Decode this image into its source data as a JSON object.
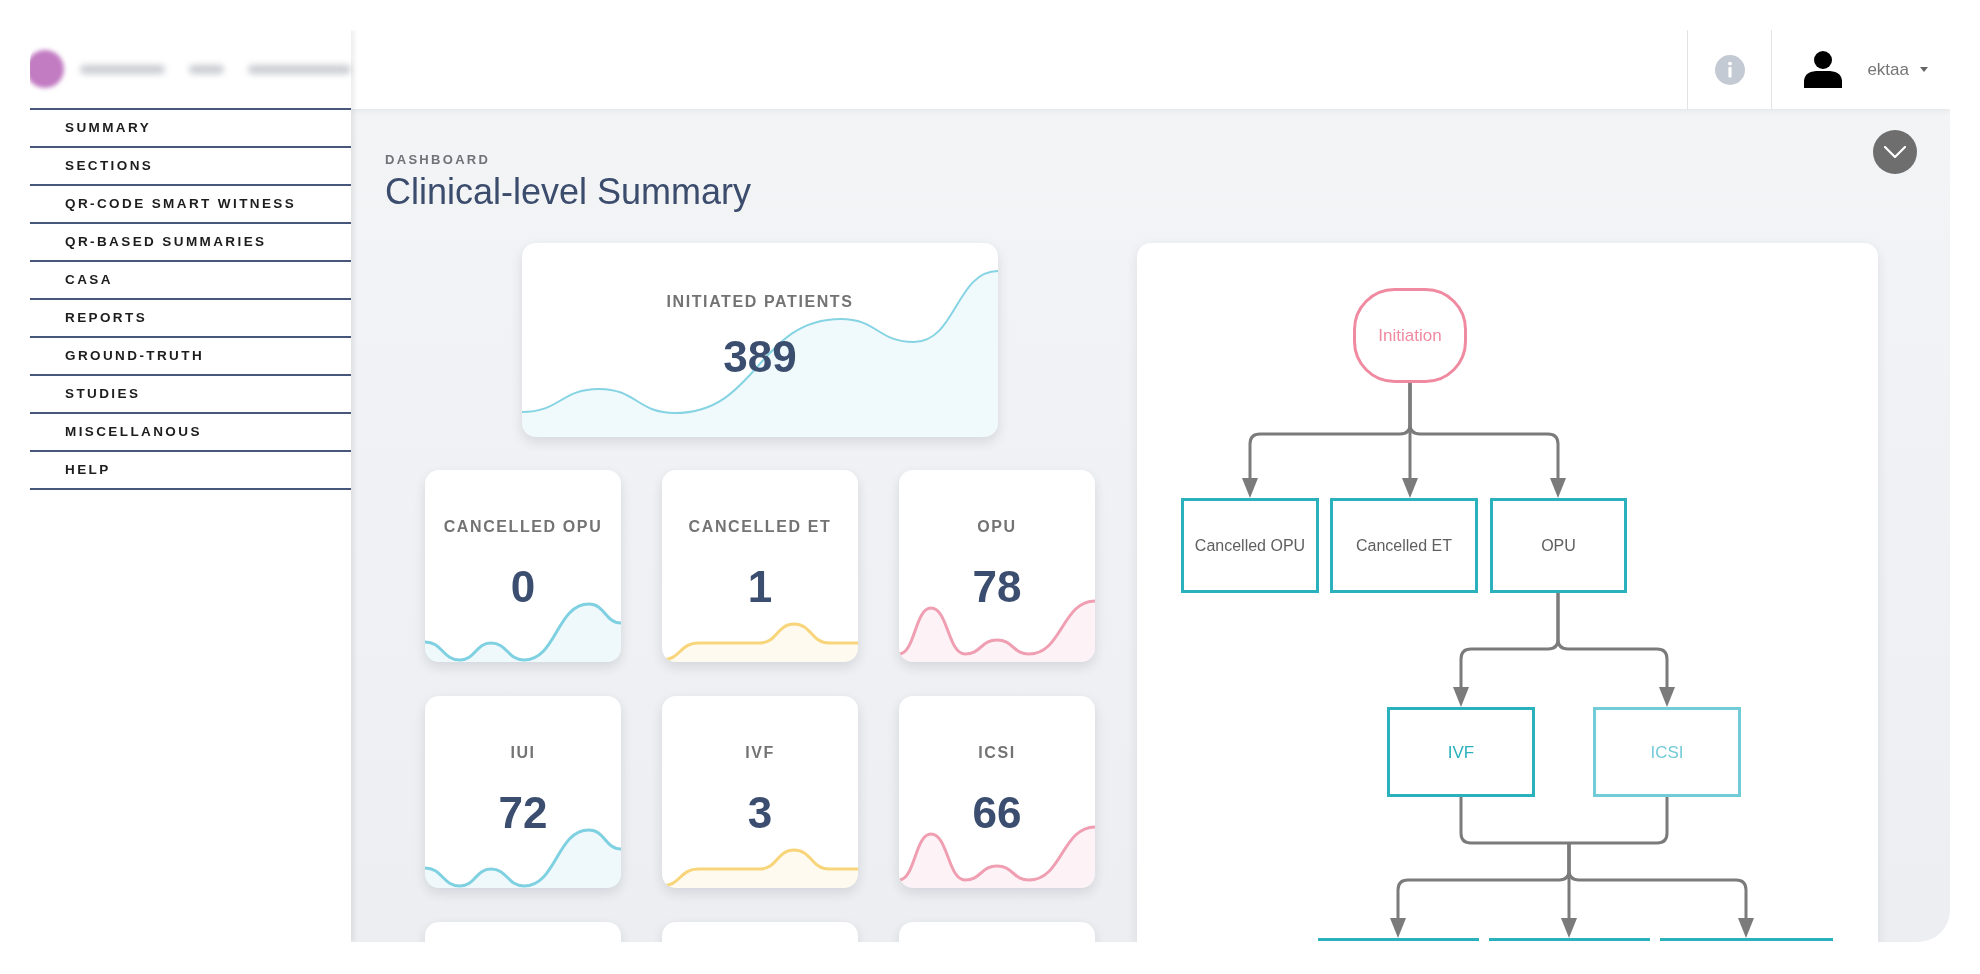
{
  "sidebar": {
    "items": [
      "SUMMARY",
      "SECTIONS",
      "QR-CODE SMART WITNESS",
      "QR-BASED SUMMARIES",
      "CASA",
      "REPORTS",
      "GROUND-TRUTH",
      "STUDIES",
      "MISCELLANOUS",
      "HELP"
    ]
  },
  "top_bar": {
    "username": "ektaa"
  },
  "page": {
    "breadcrumb": "DASHBOARD",
    "title": "Clinical-level Summary"
  },
  "highlight_card": {
    "label": "INITIATED PATIENTS",
    "value": "389",
    "color": "#86d3e3"
  },
  "stat_cards": [
    {
      "label": "CANCELLED OPU",
      "value": "0",
      "kind": "wave",
      "color": "#7fd1e2"
    },
    {
      "label": "CANCELLED ET",
      "value": "1",
      "kind": "bump",
      "color": "#f8d57a"
    },
    {
      "label": "OPU",
      "value": "78",
      "kind": "peaks",
      "color": "#f09fb2"
    },
    {
      "label": "IUI",
      "value": "72",
      "kind": "wave",
      "color": "#7fd1e2"
    },
    {
      "label": "IVF",
      "value": "3",
      "kind": "bump",
      "color": "#f8d57a"
    },
    {
      "label": "ICSI",
      "value": "66",
      "kind": "peaks",
      "color": "#f09fb2"
    },
    {
      "kind": "clipped"
    },
    {
      "kind": "clipped"
    },
    {
      "kind": "clipped"
    }
  ],
  "flowchart": {
    "nodes": [
      {
        "label": "Initiation",
        "kind": "terminal",
        "color": "#f08aa0"
      },
      {
        "label": "Cancelled OPU",
        "kind": "process",
        "color": "#2ab1bb"
      },
      {
        "label": "Cancelled ET",
        "kind": "process",
        "color": "#2ab1bb"
      },
      {
        "label": "OPU",
        "kind": "process",
        "color": "#2ab1bb"
      },
      {
        "label": "IVF",
        "kind": "result",
        "color": "#2ab1bb"
      },
      {
        "label": "ICSI",
        "kind": "result",
        "color": "#72ccd7"
      },
      {
        "kind": "clipped",
        "color": "#2ab1bb"
      },
      {
        "kind": "clipped",
        "color": "#2ab1bb"
      },
      {
        "kind": "clipped",
        "color": "#2ab1bb"
      }
    ]
  }
}
